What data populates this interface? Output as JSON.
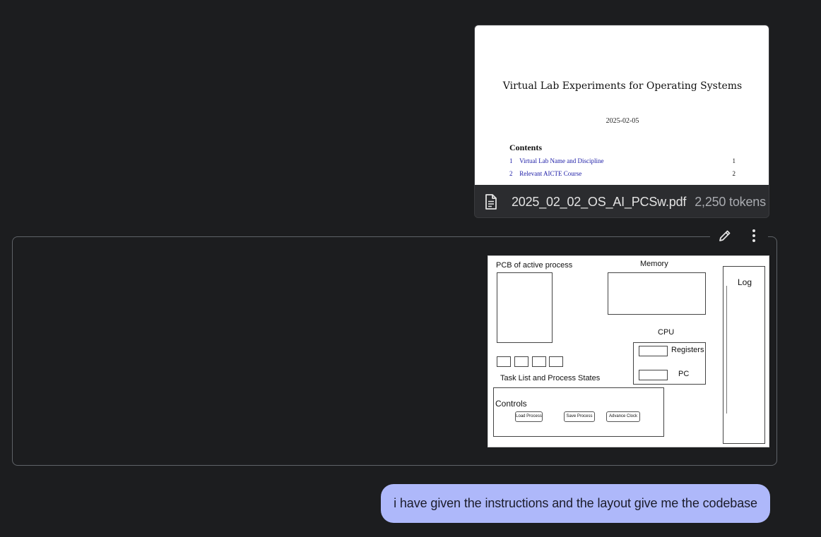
{
  "attachment": {
    "file_name": "2025_02_02_OS_AI_PCSw.pdf",
    "tokens": "2,250 tokens",
    "preview": {
      "title": "Virtual Lab Experiments for Operating Systems",
      "date": "2025-02-05",
      "contents_heading": "Contents",
      "toc": [
        {
          "num": "1",
          "label": "Virtual Lab Name and Discipline",
          "page": "1"
        },
        {
          "num": "2",
          "label": "Relevant AICTE Course",
          "page": "2"
        }
      ]
    }
  },
  "message_actions": {
    "edit_icon": "pencil-icon",
    "more_icon": "more-vert-icon"
  },
  "wireframe": {
    "pcb_label": "PCB of active process",
    "memory_label": "Memory",
    "log_label": "Log",
    "cpu_label": "CPU",
    "registers_label": "Registers",
    "pc_label": "PC",
    "task_list_label": "Task List and Process States",
    "controls_label": "Controls",
    "buttons": {
      "load": "Load Process",
      "save": "Save Process",
      "advance": "Advance Clock"
    }
  },
  "user_message": {
    "text": "i have given the instructions and the layout give me the codebase"
  },
  "colors": {
    "background": "#1c1d1f",
    "bubble": "#aeb8fa",
    "frame_border": "#5f6368",
    "link_blue": "#1a1aa6"
  }
}
